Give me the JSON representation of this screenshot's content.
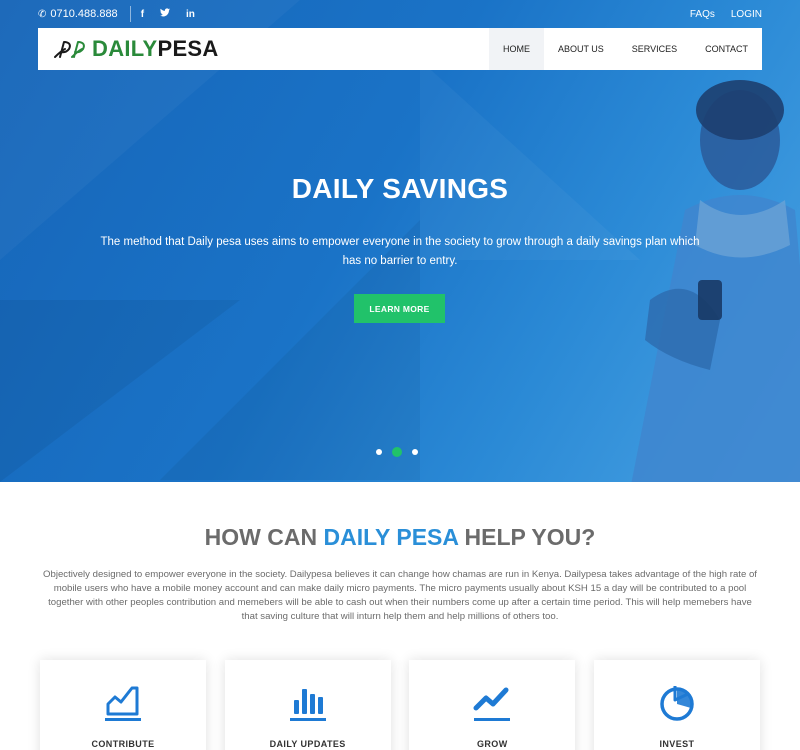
{
  "topbar": {
    "phone": "0710.488.888",
    "social": {
      "facebook": "f",
      "twitter": "t",
      "linkedin": "in"
    },
    "links": {
      "faqs": "FAQs",
      "login": "LOGIN"
    }
  },
  "brand": {
    "daily": "DAILY",
    "pesa": "PESA",
    "logo_icon": "dp-logo-icon"
  },
  "nav": {
    "home": "HOME",
    "about": "ABOUT US",
    "services": "SERVICES",
    "contact": "CONTACT",
    "active": "HOME"
  },
  "hero": {
    "title": "DAILY SAVINGS",
    "text": "The method that Daily pesa uses aims to empower everyone in the society to grow through a daily savings plan which has no barrier to entry.",
    "button": "LEARN MORE",
    "slide_count": 3,
    "active_slide": 2
  },
  "help": {
    "title_start": "HOW CAN ",
    "title_accent": "DAILY PESA",
    "title_end": " HELP YOU?",
    "text": "Objectively designed to empower everyone in the society. Dailypesa believes it can change how chamas are run in Kenya. Dailypesa takes advantage of the high rate of mobile users who have a mobile money account and can make daily micro payments. The micro payments usually about KSH 15 a day will be contributed to a pool together with other peoples contribution and memebers will be able to cash out when their numbers come up after a certain time period. This will help memebers have that saving culture that will inturn help them and help millions of others too."
  },
  "cards": [
    {
      "label": "CONTRIBUTE",
      "icon": "area-chart-icon"
    },
    {
      "label": "DAILY UPDATES",
      "icon": "bar-chart-icon"
    },
    {
      "label": "GROW",
      "icon": "line-chart-icon"
    },
    {
      "label": "INVEST",
      "icon": "pie-chart-icon"
    }
  ],
  "colors": {
    "accent_blue": "#2a8fd8",
    "brand_green": "#2a8a3a",
    "button_green": "#21c26a",
    "hero_blue": "#1a73c7"
  }
}
